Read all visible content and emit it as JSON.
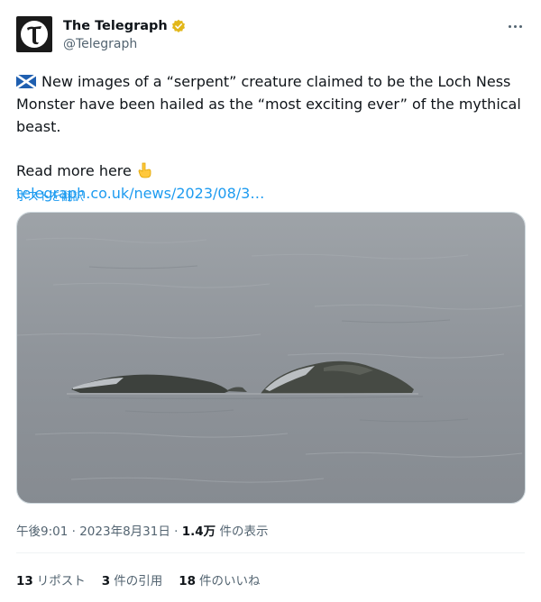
{
  "author": {
    "display_name": "The Telegraph",
    "handle": "@Telegraph",
    "avatar_icon": "telegraph-t-logo",
    "verified_color": "#e2b719"
  },
  "tweet": {
    "flag_icon": "scotland-flag",
    "line1": "New images of a “serpent” creature claimed to be the Loch Ness Monster have been hailed as the “most exciting ever” of the mythical beast.",
    "read_more": "Read more here",
    "pointing_icon": "pointing-down-emoji",
    "link": "telegraph.co.uk/news/2023/08/3…",
    "translate": "ポストを翻訳"
  },
  "meta": {
    "time": "午後9:01",
    "separator": "·",
    "date": "2023年8月31日",
    "views_count": "1.4万",
    "views_label": "件の表示"
  },
  "stats": {
    "reposts_count": "13",
    "reposts_label": "リポスト",
    "quotes_count": "3",
    "quotes_label": "件の引用",
    "likes_count": "18",
    "likes_label": "件のいいね"
  },
  "colors": {
    "link": "#1d9bf0",
    "secondary_text": "#536471",
    "water": "#8f949a"
  }
}
